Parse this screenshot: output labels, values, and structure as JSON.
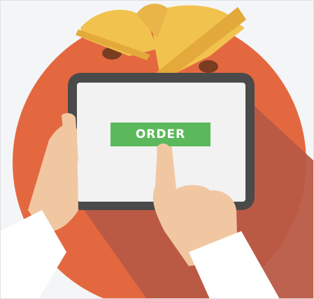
{
  "order_button": {
    "label": "ORDER"
  },
  "icons": {
    "bells": "bell-icon",
    "tablet": "tablet-icon",
    "hands": "hand-icon"
  },
  "colors": {
    "background": "#f4f5f7",
    "circle": "#e4683f",
    "circle_shadow": "#b85a45",
    "bell_gold": "#f2c24f",
    "bell_dark": "#e3a93a",
    "tablet_frame": "#4a4a4a",
    "tablet_screen": "#f2f2f2",
    "button_green": "#5cb85c",
    "skin": "#f1c7a2",
    "sleeve": "#ffffff"
  }
}
